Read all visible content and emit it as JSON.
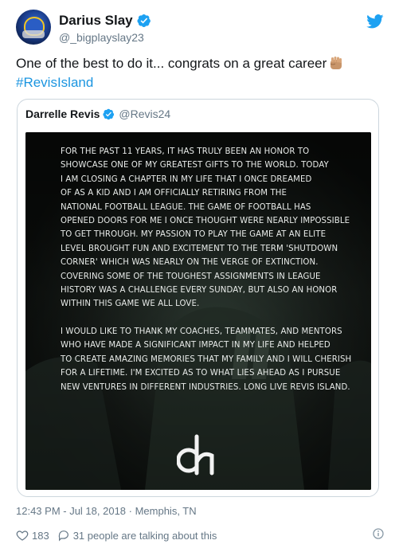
{
  "author": {
    "display_name": "Darius Slay",
    "handle": "@_bigplayslay23",
    "verified_icon": "verified-badge-icon"
  },
  "tweet": {
    "text_line1": "One of the best to do it... congrats on a great career",
    "emoji": "raised-fist-icon",
    "hashtag": "#RevisIsland"
  },
  "quoted": {
    "display_name": "Darrelle Revis",
    "handle": "@Revis24",
    "statement_lines": [
      "For the past 11 years, it has truly been an honor to",
      "showcase one of my greatest gifts to the world. Today",
      "I am closing a chapter in my life that I once dreamed",
      "of as a kid and I am officially retiring from the",
      "National Football League. The game of football has",
      "opened doors for me I once thought were nearly impossible",
      "to get through. My passion to play the game at an elite",
      "level brought fun and excitement to the term 'Shutdown",
      "Corner' which was nearly on the verge of extinction.",
      "Covering some of the toughest assignments in League",
      "history was a challenge every Sunday, but also an honor",
      "within this game we all love."
    ],
    "statement_lines_2": [
      "I would like to thank my coaches, teammates, and mentors",
      "who have made a significant impact in my life and helped",
      "to create amazing memories that my family and I will cherish",
      "for a lifetime. I'm excited as to what lies ahead as I pursue",
      "new ventures in different industries. Long live Revis Island."
    ],
    "logo_icon": "dr-monogram-logo"
  },
  "meta": {
    "timestamp": "12:43 PM - Jul 18, 2018 · Memphis, TN",
    "likes": "183",
    "talking": "31 people are talking about this"
  },
  "colors": {
    "link": "#1b95e0",
    "secondary_text": "#657786",
    "border": "#ccd6dd",
    "twitter_blue": "#1da1f2"
  }
}
